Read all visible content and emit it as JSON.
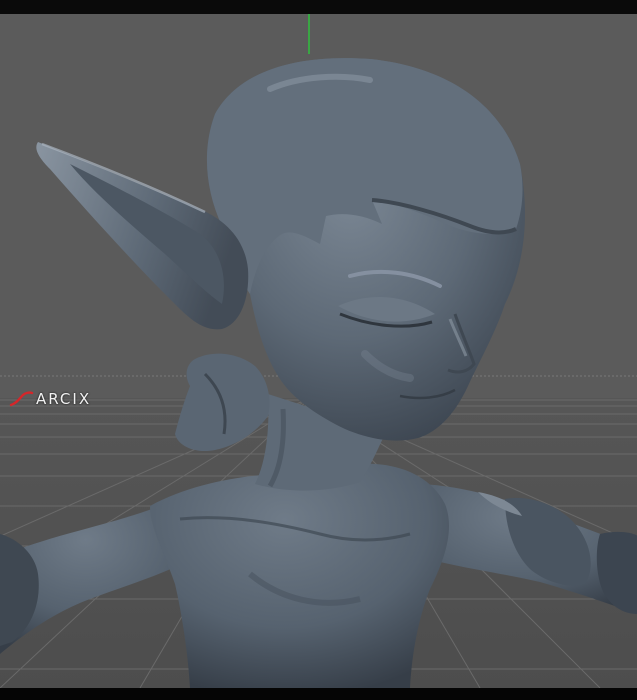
{
  "viewport": {
    "background_color": "#5a5a5a",
    "grid_color": "#676767",
    "axis_color": "#2fbf3c",
    "model_color": "#5f6b78"
  },
  "watermark": {
    "text": "ARCIX",
    "logo": "red-s-swoosh-icon",
    "accent_color": "#d4262a"
  }
}
